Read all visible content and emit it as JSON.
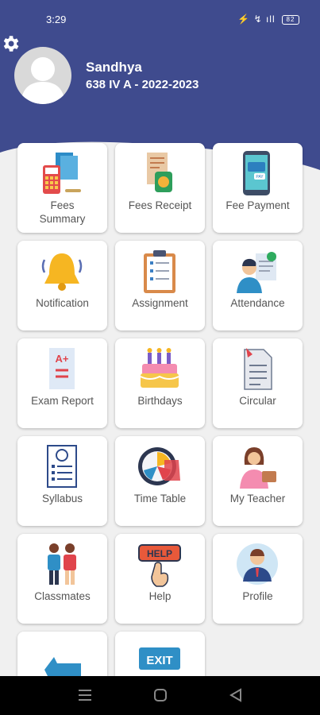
{
  "status_bar": {
    "time": "3:29",
    "signal": "⚡ ↯ ıll",
    "battery": "82"
  },
  "profile": {
    "name": "Sandhya",
    "class": "638 IV A - 2022-2023"
  },
  "tiles": [
    {
      "label": "Fees\nSummary",
      "icon": "calculator-icon"
    },
    {
      "label": "Fees Receipt",
      "icon": "receipt-icon"
    },
    {
      "label": "Fee Payment",
      "icon": "phone-payment-icon"
    },
    {
      "label": "Notification",
      "icon": "bell-icon"
    },
    {
      "label": "Assignment",
      "icon": "clipboard-icon"
    },
    {
      "label": "Attendance",
      "icon": "attendance-icon"
    },
    {
      "label": "Exam Report",
      "icon": "exam-report-icon"
    },
    {
      "label": "Birthdays",
      "icon": "cake-icon"
    },
    {
      "label": "Circular",
      "icon": "circular-doc-icon"
    },
    {
      "label": "Syllabus",
      "icon": "syllabus-icon"
    },
    {
      "label": "Time Table",
      "icon": "clock-icon"
    },
    {
      "label": "My Teacher",
      "icon": "teacher-icon"
    },
    {
      "label": "Classmates",
      "icon": "classmates-icon"
    },
    {
      "label": "Help",
      "icon": "help-icon"
    },
    {
      "label": "Profile",
      "icon": "profile-icon"
    },
    {
      "label": "",
      "icon": "arrow-back-icon"
    },
    {
      "label": "",
      "icon": "exit-icon"
    }
  ],
  "exit_text": "EXIT",
  "help_text": "HELP",
  "pay_text": "PAY",
  "exam_grade": "A+",
  "colors": {
    "header": "#3f4b8e",
    "background": "#f0f0f0"
  }
}
